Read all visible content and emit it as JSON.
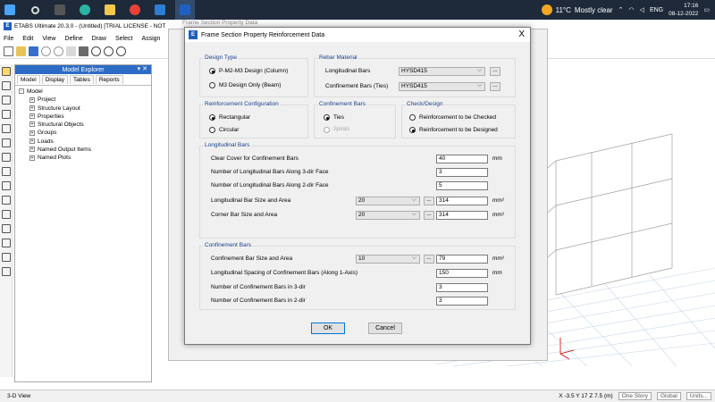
{
  "taskbar": {
    "temperature": "11°C",
    "weather": "Mostly clear",
    "language": "ENG",
    "time": "17:16",
    "date": "08-12-2022"
  },
  "app": {
    "title": "ETABS Ultimate 20.3.0 - (Untitled) [TRIAL LICENSE - NOT",
    "logo": "E",
    "menus": [
      "File",
      "Edit",
      "View",
      "Define",
      "Draw",
      "Select",
      "Assign"
    ]
  },
  "explorer": {
    "title": "Model Explorer",
    "tabs": [
      "Model",
      "Display",
      "Tables",
      "Reports"
    ],
    "root": "Model",
    "items": [
      "Project",
      "Structure Layout",
      "Properties",
      "Structural Objects",
      "Groups",
      "Loads",
      "Named Output Items",
      "Named Plots"
    ]
  },
  "behind_dialog_title": "Frame Section Property Data",
  "dialog": {
    "title": "Frame Section Property Reinforcement Data",
    "close": "X",
    "design_type": {
      "title": "Design Type",
      "opt1": "P-M2-M3 Design  (Column)",
      "opt2": "M3 Design Only  (Beam)"
    },
    "rebar_material": {
      "title": "Rebar Material",
      "long_label": "Longitudinal Bars",
      "long_value": "HYSD415",
      "conf_label": "Confinement Bars (Ties)",
      "conf_value": "HYSD415"
    },
    "reinf_config": {
      "title": "Reinforcement Configuration",
      "opt1": "Rectangular",
      "opt2": "Circular"
    },
    "conf_bars_type": {
      "title": "Confinement Bars",
      "opt1": "Ties",
      "opt2": "Spirals"
    },
    "check_design": {
      "title": "Check/Design",
      "opt1": "Reinforcement to be Checked",
      "opt2": "Reinforcement to be Designed"
    },
    "longitudinal": {
      "title": "Longitudinal Bars",
      "cover_label": "Clear Cover for Confinement Bars",
      "cover_value": "40",
      "cover_unit": "mm",
      "n3_label": "Number of Longitudinal Bars Along 3-dir Face",
      "n3_value": "3",
      "n2_label": "Number of Longitudinal Bars Along 2-dir Face",
      "n2_value": "5",
      "bar_label": "Longitudinal Bar Size and Area",
      "bar_size": "20",
      "bar_area": "314",
      "bar_unit": "mm²",
      "corner_label": "Corner Bar Size and Area",
      "corner_size": "20",
      "corner_area": "314",
      "corner_unit": "mm²"
    },
    "confinement": {
      "title": "Confinement Bars",
      "bar_label": "Confinement Bar Size and Area",
      "bar_size": "10",
      "bar_area": "79",
      "bar_unit": "mm²",
      "spacing_label": "Longitudinal Spacing of Confinement Bars  (Along 1-Axis)",
      "spacing_value": "150",
      "spacing_unit": "mm",
      "n3_label": "Number of Confinement Bars in 3-dir",
      "n3_value": "3",
      "n2_label": "Number of Confinement Bars in 2-dir",
      "n2_value": "3"
    },
    "ok": "OK",
    "cancel": "Cancel",
    "dots": "..."
  },
  "status": {
    "view": "3-D View",
    "coords": "X -3.5  Y 17  Z 7.5 (m)",
    "story": "One Story",
    "coord_sys": "Global",
    "units": "Units..."
  }
}
